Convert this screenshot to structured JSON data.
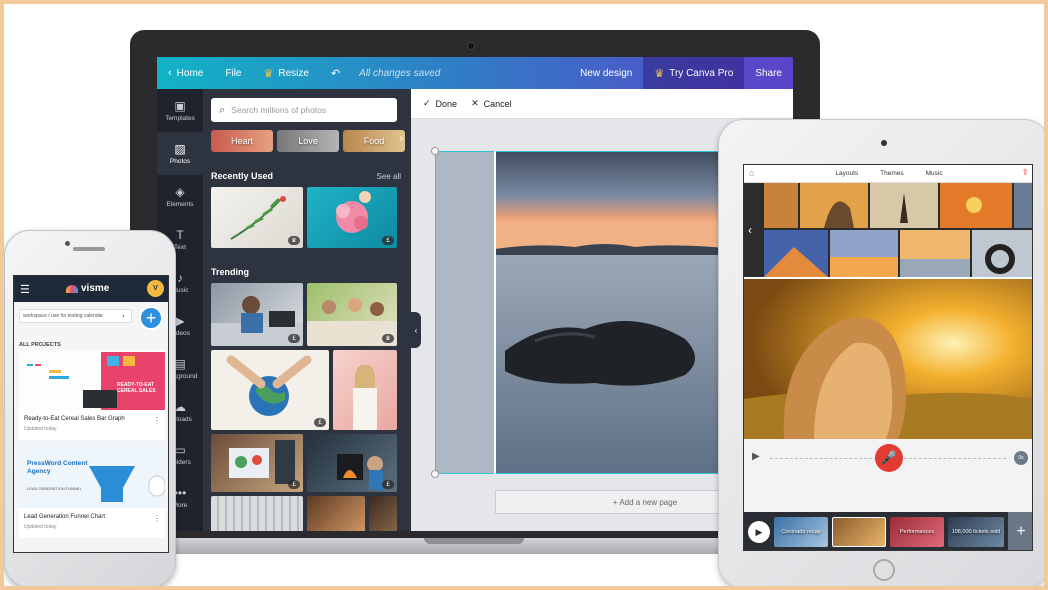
{
  "laptop": {
    "topbar": {
      "home": "Home",
      "file": "File",
      "resize": "Resize",
      "saved_status": "All changes saved",
      "new_design": "New design",
      "try_pro": "Try Canva Pro",
      "share": "Share"
    },
    "rail": [
      {
        "label": "Templates",
        "icon": "layout-icon"
      },
      {
        "label": "Photos",
        "icon": "image-icon"
      },
      {
        "label": "Elements",
        "icon": "shapes-icon"
      },
      {
        "label": "Text",
        "icon": "text-icon"
      },
      {
        "label": "Music",
        "icon": "music-icon"
      },
      {
        "label": "Videos",
        "icon": "video-icon"
      },
      {
        "label": "Background",
        "icon": "background-icon"
      },
      {
        "label": "Uploads",
        "icon": "upload-cloud-icon"
      },
      {
        "label": "Folders",
        "icon": "folder-icon"
      },
      {
        "label": "More",
        "icon": "more-icon"
      }
    ],
    "panel": {
      "search_placeholder": "Search millions of photos",
      "chips": [
        "Heart",
        "Love",
        "Food"
      ],
      "recently_used": "Recently Used",
      "see_all": "See all",
      "trending": "Trending",
      "badge_crown": "♛",
      "badge_pound": "£"
    },
    "canvas": {
      "done": "Done",
      "cancel": "Cancel",
      "add_page": "+ Add a new page"
    }
  },
  "tablet": {
    "tabs": [
      "Layouts",
      "Themes",
      "Music"
    ],
    "time_badge": "0s",
    "clips": [
      "Coronado recap",
      "",
      "Performances",
      "198,000 tickets sold"
    ]
  },
  "phone": {
    "brand": "visme",
    "avatar_initial": "V",
    "search_text": "workspace / use for testing calendar",
    "section_label": "ALL PROJECTS",
    "projects": [
      {
        "title": "Ready-to-Eat Cereal Sales Bar Graph",
        "updated": "Updated today",
        "thumb_text": "READY-TO-EAT CEREAL SALES"
      },
      {
        "title": "Lead Generation Funnel Chart",
        "updated": "Updated today",
        "thumb_text": "PressWord Content Agency",
        "thumb_sub": "LEAD GENERATION FUNNEL"
      }
    ]
  },
  "colors": {
    "canva_gradient_start": "#12b3c6",
    "canva_gradient_end": "#5b43c9",
    "canva_panel": "#2d3440",
    "canva_rail": "#1e232c",
    "crown": "#f6c343",
    "mic_red": "#e33a33",
    "visme_header": "#1e2a3a",
    "visme_fab": "#2d8fe0"
  }
}
